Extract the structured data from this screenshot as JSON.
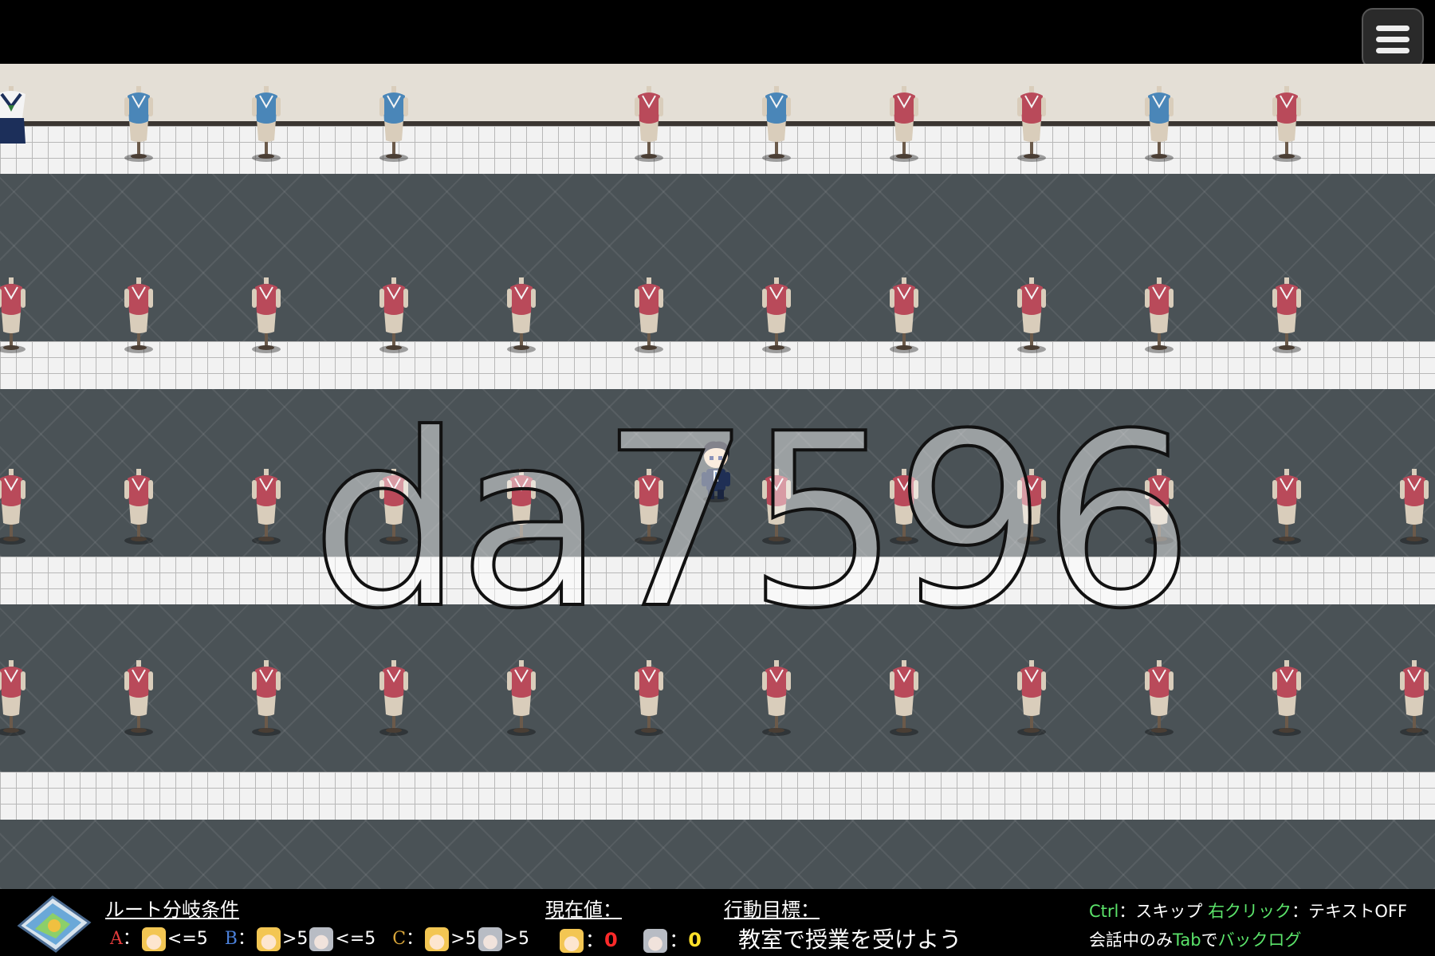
{
  "watermark": "da7596",
  "hud": {
    "route_title": "ルート分岐条件",
    "routes": [
      {
        "letter": "A",
        "letter_color": "#e23b3b",
        "sep": "：",
        "cond1": "<=5"
      },
      {
        "letter": "B",
        "letter_color": "#4a7fd8",
        "sep": "：",
        "cond1": ">5",
        "cond2": "<=5"
      },
      {
        "letter": "C",
        "letter_color": "#d9a63a",
        "sep": "：",
        "cond1": ">5",
        "cond2": ">5"
      }
    ],
    "current_title": "現在値：",
    "current_values": [
      {
        "sep": "：",
        "value": "0",
        "color": "#ff2a2a"
      },
      {
        "sep": "：",
        "value": "0",
        "color": "#ffe12a"
      }
    ],
    "objective_title": "行動目標：",
    "objective_text": "教室で授業を受けよう",
    "controls": {
      "line1": [
        {
          "text": "Ctrl",
          "color": "#5be36a"
        },
        {
          "text": "：スキップ ",
          "color": "#ffffff"
        },
        {
          "text": "右クリック",
          "color": "#5be36a"
        },
        {
          "text": "：テキストOFF",
          "color": "#ffffff"
        }
      ],
      "line2": [
        {
          "text": "会話中のみ",
          "color": "#ffffff"
        },
        {
          "text": "Tab",
          "color": "#5be36a"
        },
        {
          "text": "で",
          "color": "#ffffff"
        },
        {
          "text": "バックログ",
          "color": "#5be36a"
        }
      ]
    }
  },
  "colors": {
    "mannequin_red": "#b94a5a",
    "mannequin_blue": "#4a86b8",
    "carpet": "#4a5256",
    "floor_tile": "#f2f2f2",
    "wall": "#e4dfd6"
  },
  "icons": [
    "menu-icon",
    "game-logo-icon",
    "mannequin-icon",
    "player-character-icon",
    "character-face-icon"
  ]
}
